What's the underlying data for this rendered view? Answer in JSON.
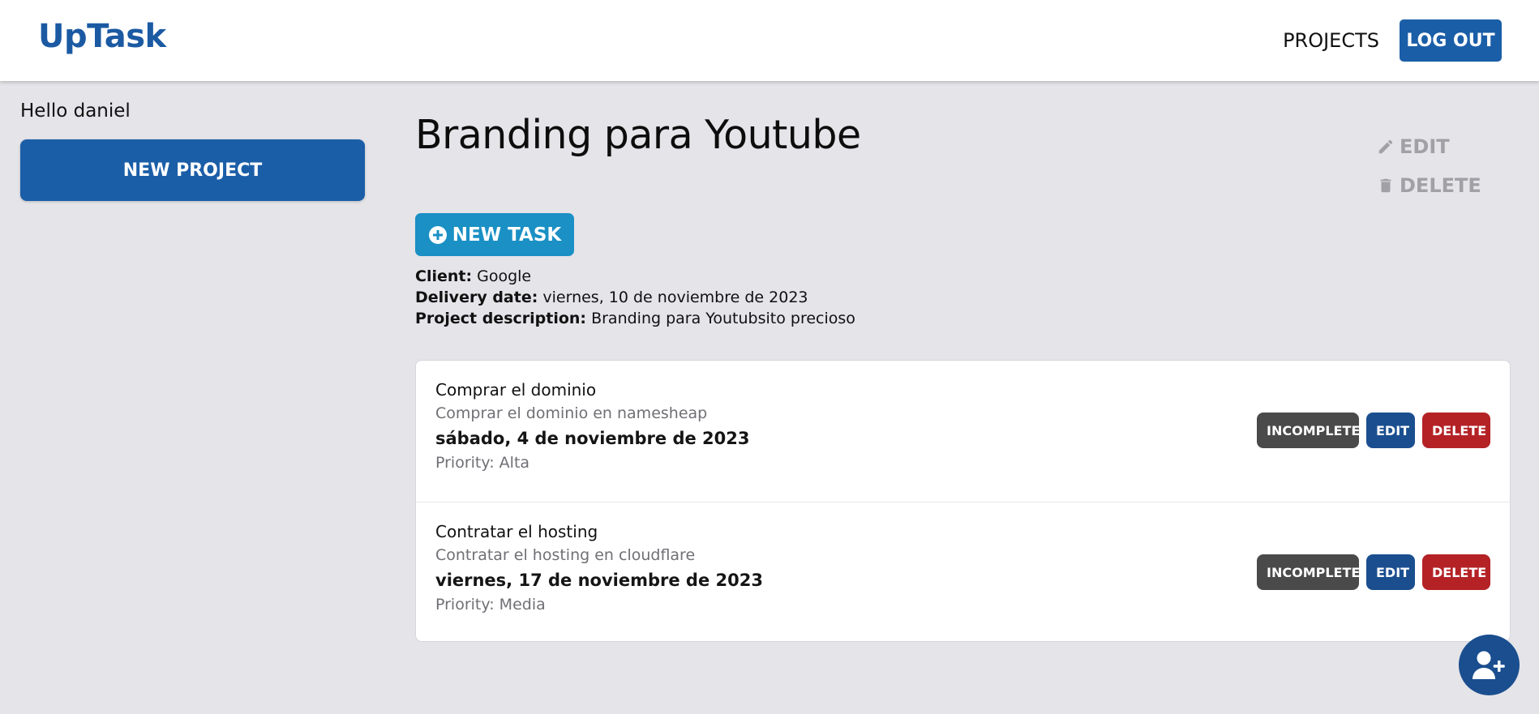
{
  "header": {
    "logo": "UpTask",
    "nav_projects": "PROJECTS",
    "logout": "LOG OUT"
  },
  "sidebar": {
    "greeting": "Hello daniel",
    "new_project": "NEW PROJECT"
  },
  "project": {
    "title": "Branding para Youtube",
    "edit": "EDIT",
    "delete": "DELETE",
    "new_task": "NEW TASK",
    "client_label": "Client:",
    "client": "Google",
    "delivery_label": "Delivery date:",
    "delivery": "viernes, 10 de noviembre de 2023",
    "description_label": "Project description:",
    "description": "Branding para Youtubsito precioso"
  },
  "tasks": [
    {
      "name": "Comprar el dominio",
      "description": "Comprar el dominio en namesheap",
      "date": "sábado, 4 de noviembre de 2023",
      "priority": "Priority: Alta",
      "status_label": "INCOMPLETE",
      "edit_label": "EDIT",
      "delete_label": "DELETE"
    },
    {
      "name": "Contratar el hosting",
      "description": "Contratar el hosting en cloudflare",
      "date": "viernes, 17 de noviembre de 2023",
      "priority": "Priority: Media",
      "status_label": "INCOMPLETE",
      "edit_label": "EDIT",
      "delete_label": "DELETE"
    }
  ],
  "icons": {
    "edit": "pencil-icon",
    "delete": "trash-icon",
    "new_task": "plus-circle-icon",
    "fab": "user-plus-icon"
  },
  "colors": {
    "primary": "#1b5ea8",
    "new_task": "#1a90c5",
    "incomplete": "#4a4a4a",
    "edit": "#1a4e8f",
    "delete": "#b42226",
    "background": "#e4e4e9"
  }
}
